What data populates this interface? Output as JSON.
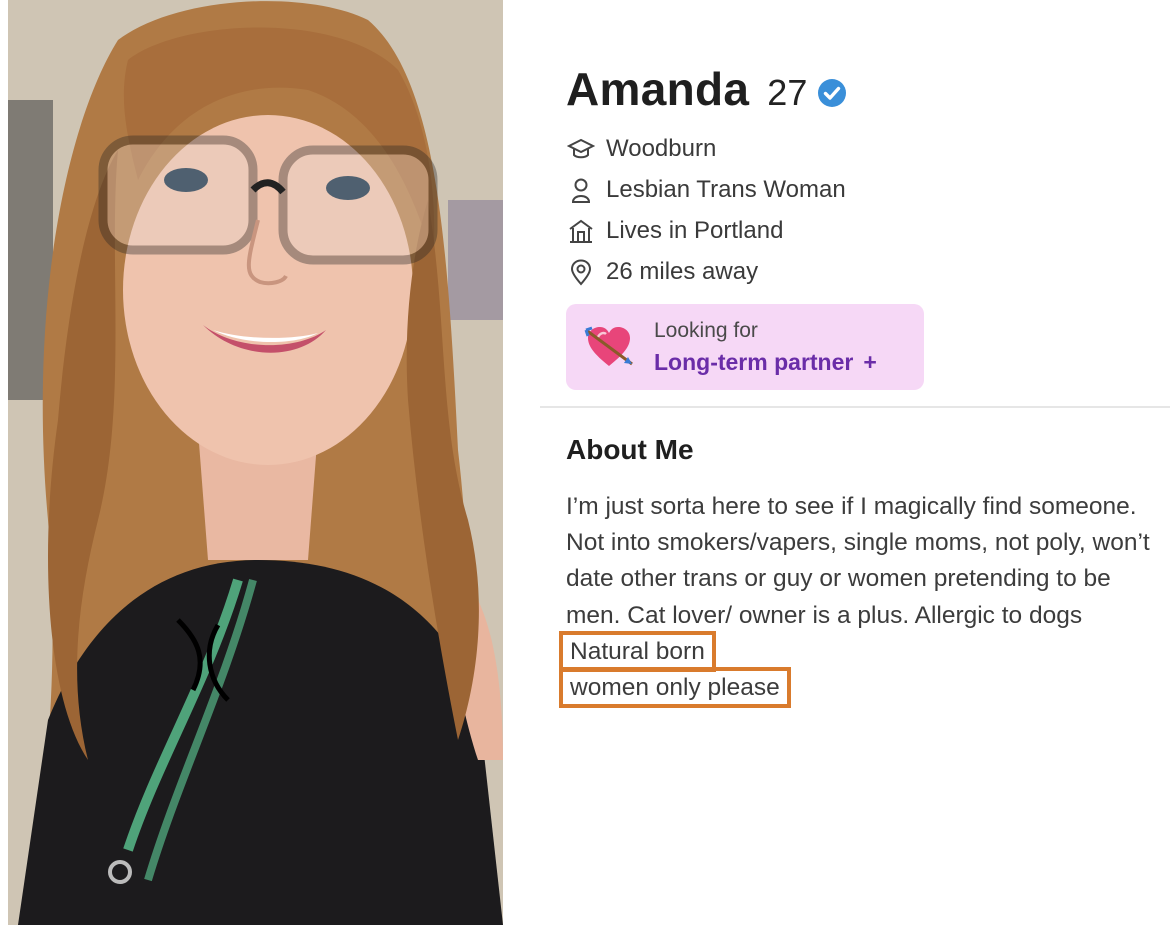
{
  "profile": {
    "name": "Amanda",
    "age": "27",
    "details": [
      {
        "icon": "graduation-cap-icon",
        "text": "Woodburn"
      },
      {
        "icon": "person-icon",
        "text": "Lesbian Trans Woman"
      },
      {
        "icon": "home-icon",
        "text": "Lives in Portland"
      },
      {
        "icon": "location-pin-icon",
        "text": "26 miles away"
      }
    ],
    "looking_for": {
      "label": "Looking for",
      "value": "Long-term partner",
      "plus": "+"
    },
    "about": {
      "title": "About Me",
      "text": "I’m just sorta here to see if I magically find someone. Not into smokers/vapers, single moms, not poly, won’t date other trans or guy or women pretending to be men. Cat lover/ owner is a plus. Allergic to dogs",
      "highlight_line1": "Natural born",
      "highlight_line2": "women only please"
    }
  },
  "colors": {
    "verified": "#3a8fd9",
    "looking_bg": "#f6d8f6",
    "looking_text": "#6a2da8",
    "highlight_box": "#d97b2d"
  }
}
